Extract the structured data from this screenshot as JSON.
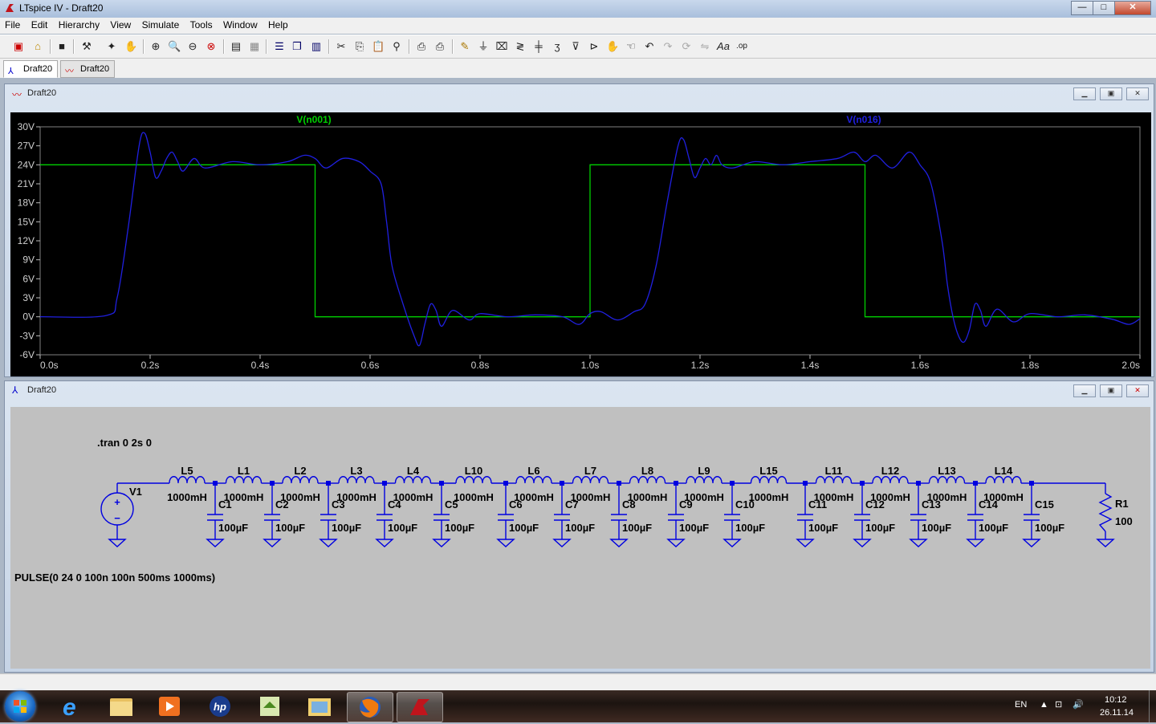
{
  "window": {
    "title": "LTspice IV - Draft20",
    "min_label": "—",
    "max_label": "□",
    "close_label": "✕"
  },
  "menu": [
    "File",
    "Edit",
    "Hierarchy",
    "View",
    "Simulate",
    "Tools",
    "Window",
    "Help"
  ],
  "tabs": [
    {
      "label": "Draft20",
      "icon": "schematic-icon"
    },
    {
      "label": "Draft20",
      "icon": "waveform-icon"
    }
  ],
  "waveform_window": {
    "title": "Draft20"
  },
  "schematic_window": {
    "title": "Draft20"
  },
  "colors": {
    "trace1": "#00d000",
    "trace2": "#2020e0",
    "grid": "#5a5a5a",
    "plot_bg": "#000000",
    "axis_text": "#d0d0d0",
    "wire": "#0000e0",
    "junction": "#0000e0"
  },
  "chart_data": {
    "type": "line",
    "xlabel": "",
    "ylabel": "",
    "xlim": [
      0,
      2.0
    ],
    "ylim": [
      -6,
      30
    ],
    "x_ticks": [
      "0.0s",
      "0.2s",
      "0.4s",
      "0.6s",
      "0.8s",
      "1.0s",
      "1.2s",
      "1.4s",
      "1.6s",
      "1.8s",
      "2.0s"
    ],
    "y_ticks": [
      "30V",
      "27V",
      "24V",
      "21V",
      "18V",
      "15V",
      "12V",
      "9V",
      "6V",
      "3V",
      "0V",
      "-3V",
      "-6V"
    ],
    "series": [
      {
        "name": "V(n001)",
        "color": "#00d000",
        "x": [
          0,
          0.5,
          0.5,
          1.0,
          1.0,
          1.5,
          1.5,
          2.0
        ],
        "y": [
          24,
          24,
          0,
          0,
          24,
          24,
          0,
          0
        ]
      },
      {
        "name": "V(n016)",
        "color": "#2020e0",
        "x": [
          0,
          0.12,
          0.14,
          0.16,
          0.18,
          0.19,
          0.2,
          0.21,
          0.22,
          0.23,
          0.24,
          0.25,
          0.26,
          0.28,
          0.3,
          0.35,
          0.4,
          0.45,
          0.48,
          0.5,
          0.52,
          0.55,
          0.58,
          0.6,
          0.62,
          0.63,
          0.64,
          0.66,
          0.68,
          0.69,
          0.7,
          0.71,
          0.72,
          0.73,
          0.75,
          0.78,
          0.8,
          0.85,
          0.9,
          0.95,
          0.98,
          1.0,
          1.02,
          1.05,
          1.08,
          1.1,
          1.12,
          1.14,
          1.16,
          1.17,
          1.18,
          1.19,
          1.2,
          1.21,
          1.22,
          1.23,
          1.24,
          1.26,
          1.3,
          1.35,
          1.4,
          1.45,
          1.48,
          1.5,
          1.52,
          1.55,
          1.58,
          1.6,
          1.62,
          1.64,
          1.65,
          1.66,
          1.67,
          1.68,
          1.69,
          1.7,
          1.71,
          1.72,
          1.74,
          1.77,
          1.8,
          1.85,
          1.9,
          1.95,
          1.98,
          2.0
        ],
        "y": [
          0,
          0.2,
          3,
          14,
          27,
          29,
          26,
          22,
          23,
          25,
          26,
          24.5,
          23,
          25,
          23.5,
          24.5,
          24,
          24.5,
          25.5,
          25,
          23.5,
          25,
          24.5,
          23,
          21,
          15,
          8,
          2,
          -3,
          -4.5,
          -1,
          2,
          1,
          -1.5,
          1,
          -0.5,
          0.5,
          0,
          0.3,
          0,
          -1.2,
          0.5,
          0.8,
          -0.5,
          0.8,
          2,
          8,
          18,
          27,
          28,
          25,
          22,
          23.5,
          25,
          24,
          25.5,
          24,
          23.5,
          24.5,
          24,
          24.5,
          25,
          26,
          24.5,
          25.5,
          23.5,
          26,
          24,
          21,
          12,
          5,
          0,
          -3,
          -4,
          -2,
          2,
          1,
          -1.5,
          1.2,
          -0.8,
          0.5,
          0,
          0.3,
          -0.4,
          -1.2,
          -0.3
        ]
      }
    ]
  },
  "schematic": {
    "directive": ".tran 0 2s 0",
    "source_name": "V1",
    "source_value": "PULSE(0 24 0 100n 100n 500ms 1000ms)",
    "inductors": [
      {
        "name": "L5",
        "value": "1000mH"
      },
      {
        "name": "L1",
        "value": "1000mH"
      },
      {
        "name": "L2",
        "value": "1000mH"
      },
      {
        "name": "L3",
        "value": "1000mH"
      },
      {
        "name": "L4",
        "value": "1000mH"
      },
      {
        "name": "L10",
        "value": "1000mH"
      },
      {
        "name": "L6",
        "value": "1000mH"
      },
      {
        "name": "L7",
        "value": "1000mH"
      },
      {
        "name": "L8",
        "value": "1000mH"
      },
      {
        "name": "L9",
        "value": "1000mH"
      },
      {
        "name": "L15",
        "value": "1000mH"
      },
      {
        "name": "L11",
        "value": "1000mH"
      },
      {
        "name": "L12",
        "value": "1000mH"
      },
      {
        "name": "L13",
        "value": "1000mH"
      },
      {
        "name": "L14",
        "value": "1000mH"
      }
    ],
    "capacitors": [
      {
        "name": "C1",
        "value": "100µF"
      },
      {
        "name": "C2",
        "value": "100µF"
      },
      {
        "name": "C3",
        "value": "100µF"
      },
      {
        "name": "C4",
        "value": "100µF"
      },
      {
        "name": "C5",
        "value": "100µF"
      },
      {
        "name": "C6",
        "value": "100µF"
      },
      {
        "name": "C7",
        "value": "100µF"
      },
      {
        "name": "C8",
        "value": "100µF"
      },
      {
        "name": "C9",
        "value": "100µF"
      },
      {
        "name": "C10",
        "value": "100µF"
      },
      {
        "name": "C11",
        "value": "100µF"
      },
      {
        "name": "C12",
        "value": "100µF"
      },
      {
        "name": "C13",
        "value": "100µF"
      },
      {
        "name": "C14",
        "value": "100µF"
      },
      {
        "name": "C15",
        "value": "100µF"
      }
    ],
    "resistor": {
      "name": "R1",
      "value": "100"
    }
  },
  "taskbar": {
    "lang": "EN",
    "time": "10:12",
    "date": "26.11.14",
    "apps": [
      "internet-explorer-icon",
      "file-explorer-icon",
      "media-player-icon",
      "hp-icon",
      "file-manager-icon",
      "folder-window-icon",
      "firefox-icon",
      "ltspice-icon"
    ]
  }
}
